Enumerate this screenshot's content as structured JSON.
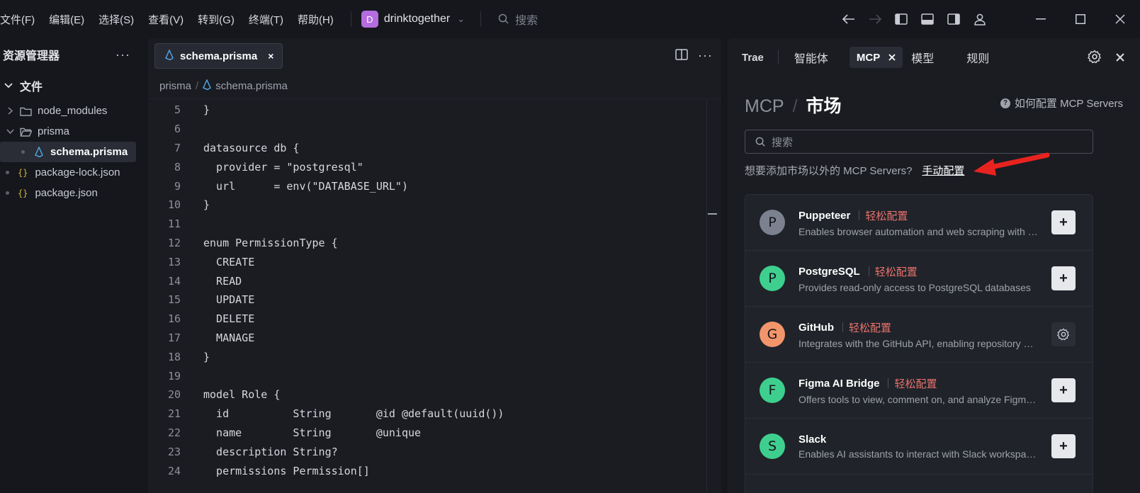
{
  "menu": [
    "文件(F)",
    "编辑(E)",
    "选择(S)",
    "查看(V)",
    "转到(G)",
    "终端(T)",
    "帮助(H)"
  ],
  "project": {
    "badge": "D",
    "name": "drinktogether"
  },
  "top_search": {
    "placeholder": "搜索"
  },
  "sidebar": {
    "title": "资源管理器",
    "more": "···",
    "root": "文件",
    "items": [
      {
        "label": "node_modules",
        "kind": "folder",
        "expanded": false
      },
      {
        "label": "prisma",
        "kind": "folder",
        "expanded": true
      },
      {
        "label": "schema.prisma",
        "kind": "prisma",
        "active": true
      },
      {
        "label": "package-lock.json",
        "kind": "json"
      },
      {
        "label": "package.json",
        "kind": "json"
      }
    ]
  },
  "editor": {
    "tab": {
      "label": "schema.prisma",
      "close": "×"
    },
    "breadcrumb": [
      "prisma",
      "/",
      "schema.prisma"
    ],
    "lines": [
      {
        "n": "5",
        "t": "}"
      },
      {
        "n": "6",
        "t": ""
      },
      {
        "n": "7",
        "t": "datasource db {"
      },
      {
        "n": "8",
        "t": "  provider = \"postgresql\""
      },
      {
        "n": "9",
        "t": "  url      = env(\"DATABASE_URL\")"
      },
      {
        "n": "10",
        "t": "}"
      },
      {
        "n": "11",
        "t": ""
      },
      {
        "n": "12",
        "t": "enum PermissionType {"
      },
      {
        "n": "13",
        "t": "  CREATE"
      },
      {
        "n": "14",
        "t": "  READ"
      },
      {
        "n": "15",
        "t": "  UPDATE"
      },
      {
        "n": "16",
        "t": "  DELETE"
      },
      {
        "n": "17",
        "t": "  MANAGE"
      },
      {
        "n": "18",
        "t": "}"
      },
      {
        "n": "19",
        "t": ""
      },
      {
        "n": "20",
        "t": "model Role {"
      },
      {
        "n": "21",
        "t": "  id          String       @id @default(uuid())"
      },
      {
        "n": "22",
        "t": "  name        String       @unique"
      },
      {
        "n": "23",
        "t": "  description String?"
      },
      {
        "n": "24",
        "t": "  permissions Permission[]"
      }
    ]
  },
  "panel": {
    "tabs": {
      "trae": "Trae",
      "agents": "智能体",
      "mcp": "MCP",
      "models": "模型",
      "rules": "规则"
    },
    "heading": {
      "mcp": "MCP",
      "sep": "/",
      "market": "市场"
    },
    "help": "如何配置 MCP Servers",
    "search_placeholder": "搜索",
    "manual_prompt": "想要添加市场以外的 MCP Servers?",
    "manual_link": "手动配置",
    "cards": [
      {
        "letter": "P",
        "title": "Puppeteer",
        "tag": "轻松配置",
        "desc": "Enables browser automation and web scraping with Puppeteer",
        "color": "#7c8190",
        "action": "+"
      },
      {
        "letter": "P",
        "title": "PostgreSQL",
        "tag": "轻松配置",
        "desc": "Provides read-only access to PostgreSQL databases",
        "color": "#3ecf8e",
        "action": "+"
      },
      {
        "letter": "G",
        "title": "GitHub",
        "tag": "轻松配置",
        "desc": "Integrates with the GitHub API, enabling repository management",
        "color": "#f2956b",
        "action": "gear"
      },
      {
        "letter": "F",
        "title": "Figma AI Bridge",
        "tag": "轻松配置",
        "desc": "Offers tools to view, comment on, and analyze Figma files",
        "color": "#3ecf8e",
        "action": "+"
      },
      {
        "letter": "S",
        "title": "Slack",
        "tag": "",
        "desc": "Enables AI assistants to interact with Slack workspaces",
        "color": "#3ecf8e",
        "action": "+"
      }
    ]
  },
  "colors": {
    "accent_red": "#e8726c",
    "project_badge": "#b56cdf",
    "annotation_arrow": "#e8231f"
  }
}
